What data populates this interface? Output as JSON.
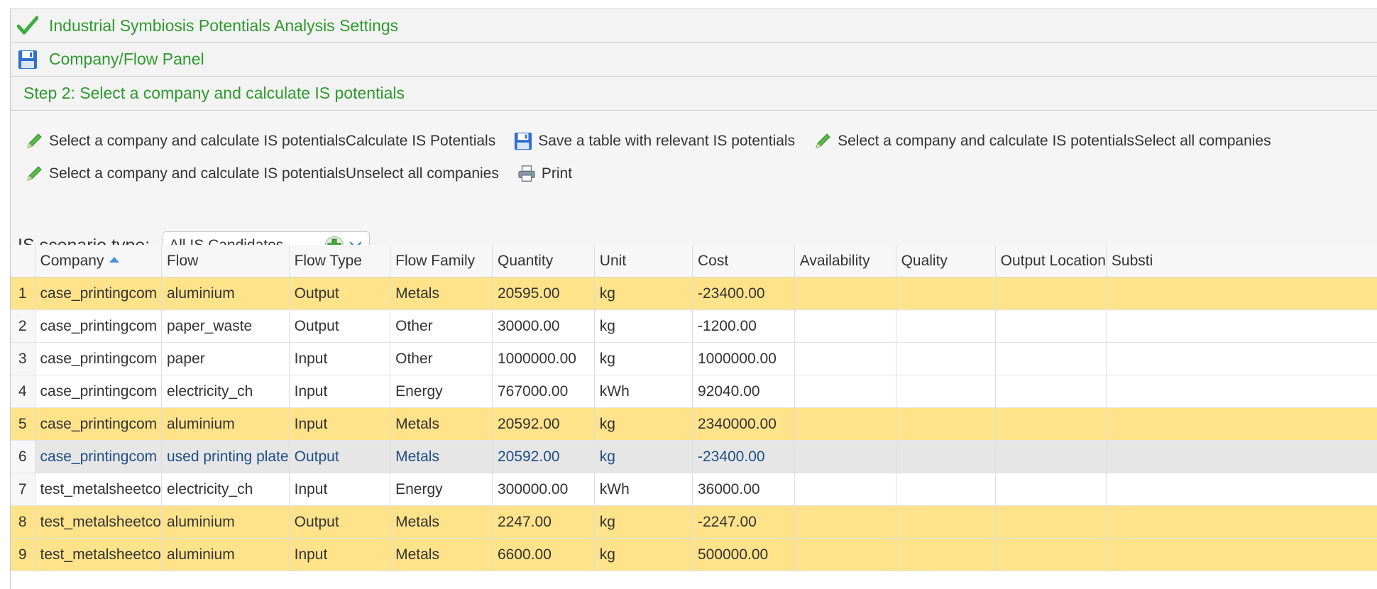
{
  "panels": {
    "settings_title": "Industrial Symbiosis Potentials Analysis Settings",
    "company_flow_title": "Company/Flow Panel",
    "step_title": "Step 2: Select a company and calculate IS potentials"
  },
  "toolbar": {
    "calculate": "Select a company and calculate IS potentialsCalculate IS Potentials",
    "save_table": "Save a table with relevant IS potentials",
    "select_all": "Select a company and calculate IS potentialsSelect all companies",
    "unselect_all": "Select a company and calculate IS potentialsUnselect all companies",
    "print": "Print"
  },
  "scenario": {
    "label": "IS scenario type:",
    "value": "All IS Candidates"
  },
  "grid": {
    "columns": [
      "Company",
      "Flow",
      "Flow Type",
      "Flow Family",
      "Quantity",
      "Unit",
      "Cost",
      "Availability",
      "Quality",
      "Output Location",
      "Substi"
    ],
    "rows": [
      {
        "n": "1",
        "company": "case_printingcom",
        "flow": "aluminium",
        "type": "Output",
        "family": "Metals",
        "qty": "20595.00",
        "unit": "kg",
        "cost": "-23400.00",
        "state": "hl"
      },
      {
        "n": "2",
        "company": "case_printingcom",
        "flow": "paper_waste",
        "type": "Output",
        "family": "Other",
        "qty": "30000.00",
        "unit": "kg",
        "cost": "-1200.00",
        "state": ""
      },
      {
        "n": "3",
        "company": "case_printingcom",
        "flow": "paper",
        "type": "Input",
        "family": "Other",
        "qty": "1000000.00",
        "unit": "kg",
        "cost": "1000000.00",
        "state": ""
      },
      {
        "n": "4",
        "company": "case_printingcom",
        "flow": "electricity_ch",
        "type": "Input",
        "family": "Energy",
        "qty": "767000.00",
        "unit": "kWh",
        "cost": "92040.00",
        "state": ""
      },
      {
        "n": "5",
        "company": "case_printingcom",
        "flow": "aluminium",
        "type": "Input",
        "family": "Metals",
        "qty": "20592.00",
        "unit": "kg",
        "cost": "2340000.00",
        "state": "hl"
      },
      {
        "n": "6",
        "company": "case_printingcom",
        "flow": "used printing plate",
        "type": "Output",
        "family": "Metals",
        "qty": "20592.00",
        "unit": "kg",
        "cost": "-23400.00",
        "state": "sel"
      },
      {
        "n": "7",
        "company": "test_metalsheetco",
        "flow": "electricity_ch",
        "type": "Input",
        "family": "Energy",
        "qty": "300000.00",
        "unit": "kWh",
        "cost": "36000.00",
        "state": ""
      },
      {
        "n": "8",
        "company": "test_metalsheetco",
        "flow": "aluminium",
        "type": "Output",
        "family": "Metals",
        "qty": "2247.00",
        "unit": "kg",
        "cost": "-2247.00",
        "state": "hl"
      },
      {
        "n": "9",
        "company": "test_metalsheetco",
        "flow": "aluminium",
        "type": "Input",
        "family": "Metals",
        "qty": "6600.00",
        "unit": "kg",
        "cost": "500000.00",
        "state": "hl"
      }
    ]
  },
  "colors": {
    "accent_green": "#2e9a2e",
    "highlight_row": "#fee38a",
    "selected_row": "#e6e6e6",
    "selected_text": "#1f4e86"
  }
}
